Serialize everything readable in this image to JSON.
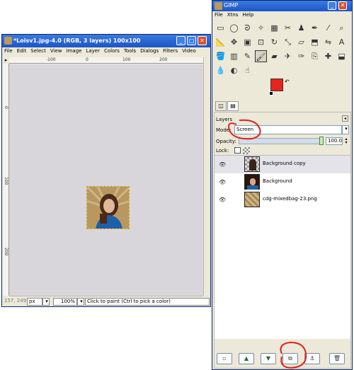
{
  "image_window": {
    "title": "*Loisv1.jpg-4.0 (RGB, 3 layers) 100x100",
    "menu": [
      "File",
      "Edit",
      "Select",
      "View",
      "Image",
      "Layer",
      "Colors",
      "Tools",
      "Dialogs",
      "Filters",
      "Video"
    ],
    "ruler_h_labels": [
      "-100",
      "0",
      "100",
      "200"
    ],
    "ruler_v_labels": [
      "0",
      "100",
      "200"
    ],
    "status": {
      "coords": "157, 249",
      "unit": "px",
      "zoom": "100%",
      "message": "Click to paint (Ctrl to pick a color)"
    }
  },
  "toolbox": {
    "title": "GIMP",
    "menu": [
      "File",
      "Xtns",
      "Help"
    ],
    "tools": [
      "rect-select",
      "ellipse-select",
      "free-select",
      "fuzzy-select",
      "color-select",
      "scissors",
      "foreground-select",
      "paths",
      "color-picker",
      "zoom",
      "measure",
      "move",
      "align",
      "crop",
      "rotate",
      "scale",
      "shear",
      "perspective",
      "flip",
      "text",
      "bucket-fill",
      "blend",
      "pencil",
      "paintbrush",
      "eraser",
      "airbrush",
      "ink",
      "clone",
      "heal",
      "perspective-clone",
      "blur",
      "dodge-burn",
      "smudge"
    ],
    "fg_color": "#e8231c",
    "bg_color": "#ffffff"
  },
  "layers": {
    "heading": "Layers",
    "mode_label": "Mode:",
    "mode_value": "Screen",
    "opacity_label": "Opacity:",
    "opacity_value": "100.0",
    "lock_label": "Lock:",
    "items": [
      {
        "name": "Background copy",
        "active": true
      },
      {
        "name": "Background",
        "active": false
      },
      {
        "name": "cdg-mixedbag-23.png",
        "active": false
      }
    ]
  },
  "annotation_color": "#e02020"
}
